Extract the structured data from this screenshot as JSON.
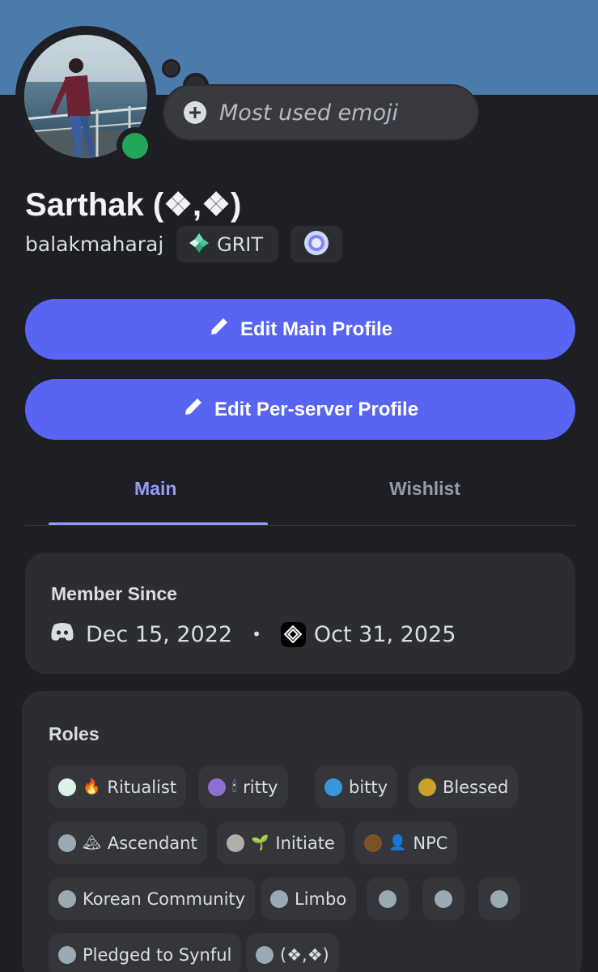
{
  "colors": {
    "banner": "#4b7bab",
    "background": "#1e1f24",
    "card": "#2b2d31",
    "accent": "#5865f2",
    "tab_active": "#949cf7",
    "status_online": "#23a55a"
  },
  "status": {
    "placeholder": "Most used emoji"
  },
  "profile": {
    "display_name": "Sarthak (❖,❖)",
    "username": "balakmaharaj",
    "guild_tag": "GRIT",
    "badge_icon": "laurel-badge-icon"
  },
  "buttons": {
    "edit_main": "Edit Main Profile",
    "edit_server": "Edit Per-server Profile"
  },
  "tabs": [
    {
      "label": "Main",
      "active": true
    },
    {
      "label": "Wishlist",
      "active": false
    }
  ],
  "member_since": {
    "title": "Member Since",
    "discord_date": "Dec 15, 2022",
    "separator": "•",
    "server_date": "Oct 31, 2025"
  },
  "roles": {
    "title": "Roles",
    "items": [
      {
        "label": "Ritualist",
        "color": "#d9f3e6",
        "emoji": "🔥"
      },
      {
        "label": "ritty",
        "color": "#8e6fd1",
        "emoji": "🕯"
      },
      {
        "label": "bitty",
        "color": "#3498db",
        "emoji": ""
      },
      {
        "label": "Blessed",
        "color": "#c9a227",
        "emoji": ""
      },
      {
        "label": "Ascendant",
        "color": "#99aab5",
        "emoji": "🏔"
      },
      {
        "label": "Initiate",
        "color": "#b0aea8",
        "emoji": "🌱"
      },
      {
        "label": "NPC",
        "color": "#7a5428",
        "emoji": "👤"
      },
      {
        "label": "Korean Community",
        "color": "#99aab5",
        "emoji": ""
      },
      {
        "label": "Limbo",
        "color": "#99aab5",
        "emoji": ""
      },
      {
        "label": "",
        "color": "#99aab5",
        "emoji": ""
      },
      {
        "label": "",
        "color": "#99aab5",
        "emoji": ""
      },
      {
        "label": "",
        "color": "#99aab5",
        "emoji": ""
      },
      {
        "label": "Pledged to Synful",
        "color": "#99aab5",
        "emoji": ""
      },
      {
        "label": "(❖,❖)",
        "color": "#99aab5",
        "emoji": ""
      }
    ]
  }
}
